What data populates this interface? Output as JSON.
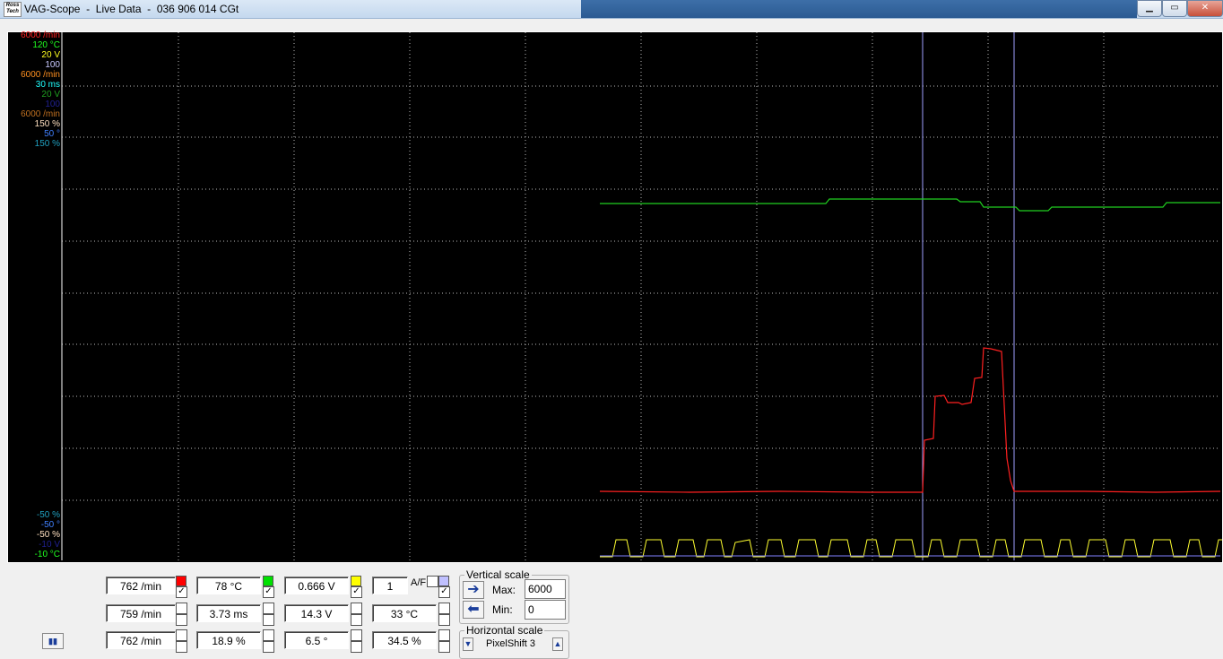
{
  "window": {
    "title": "VAG-Scope  -  Live Data  -  036 906 014 CGt",
    "logo_text": "Ross Tech"
  },
  "scope": {
    "top_scales": [
      {
        "text": "6000 /min",
        "color": "#ff2020"
      },
      {
        "text": "120 °C",
        "color": "#20ff20"
      },
      {
        "text": "20 V",
        "color": "#ffff20"
      },
      {
        "text": "100",
        "color": "#c8c8ff"
      },
      {
        "text": "6000 /min",
        "color": "#ff9020"
      },
      {
        "text": "30 ms",
        "color": "#20ffff"
      },
      {
        "text": "20 V",
        "color": "#20a020"
      },
      {
        "text": "100",
        "color": "#202090"
      },
      {
        "text": "6000 /min",
        "color": "#c07020"
      },
      {
        "text": "150 %",
        "color": "#ffe0c0"
      },
      {
        "text": "50 °",
        "color": "#4080ff"
      },
      {
        "text": "150 %",
        "color": "#20a0c0"
      }
    ],
    "bottom_scales": [
      {
        "text": "-50 %",
        "color": "#20a0c0"
      },
      {
        "text": "-50 °",
        "color": "#4080ff"
      },
      {
        "text": "-50 %",
        "color": "#ffe0c0"
      },
      {
        "text": "-10 V",
        "color": "#202090"
      },
      {
        "text": "-10 °C",
        "color": "#20ff20"
      }
    ]
  },
  "channels": [
    {
      "value": "762 /min",
      "color": "#ff0000",
      "checked": true
    },
    {
      "value": "78 °C",
      "color": "#00e000",
      "checked": true
    },
    {
      "value": "0.666 V",
      "color": "#ffff00",
      "checked": true
    },
    {
      "value": "1",
      "color": "#c0c0ff",
      "checked": true,
      "label": "A/F"
    },
    {
      "value": "759 /min",
      "color": null,
      "checked": false
    },
    {
      "value": "3.73 ms",
      "color": null,
      "checked": false
    },
    {
      "value": "14.3 V",
      "color": null,
      "checked": false
    },
    {
      "value": "33 °C",
      "color": null,
      "checked": false
    },
    {
      "value": "762 /min",
      "color": null,
      "checked": false
    },
    {
      "value": "18.9 %",
      "color": null,
      "checked": false
    },
    {
      "value": "6.5 °",
      "color": null,
      "checked": false
    },
    {
      "value": "34.5 %",
      "color": null,
      "checked": false
    }
  ],
  "vertical_scale": {
    "title": "Vertical scale",
    "max_label": "Max:",
    "max_value": "6000",
    "min_label": "Min:",
    "min_value": "0"
  },
  "horizontal_scale": {
    "title": "Horizontal scale",
    "pixelshift": "PixelShift 3"
  }
}
